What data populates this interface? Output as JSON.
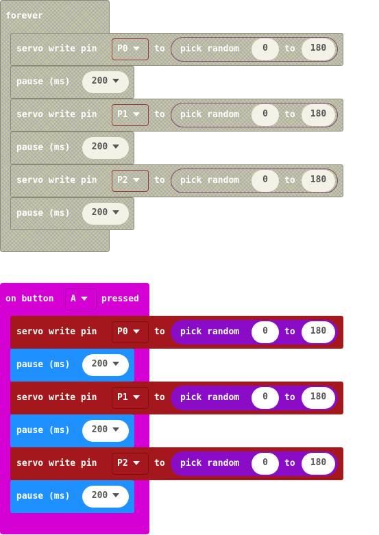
{
  "forever_block": {
    "label": "forever",
    "disabled": true,
    "statements": [
      {
        "kind": "servo",
        "label": "servo write pin",
        "pin": "P0",
        "to": "to",
        "random_label": "pick random",
        "from": "0",
        "to2": "to",
        "max": "180"
      },
      {
        "kind": "pause",
        "label": "pause (ms)",
        "value": "200"
      },
      {
        "kind": "servo",
        "label": "servo write pin",
        "pin": "P1",
        "to": "to",
        "random_label": "pick random",
        "from": "0",
        "to2": "to",
        "max": "180"
      },
      {
        "kind": "pause",
        "label": "pause (ms)",
        "value": "200"
      },
      {
        "kind": "servo",
        "label": "servo write pin",
        "pin": "P2",
        "to": "to",
        "random_label": "pick random",
        "from": "0",
        "to2": "to",
        "max": "180"
      },
      {
        "kind": "pause",
        "label": "pause (ms)",
        "value": "200"
      }
    ]
  },
  "button_block": {
    "label_prefix": "on button",
    "button": "A",
    "label_suffix": "pressed",
    "statements": [
      {
        "kind": "servo",
        "label": "servo write pin",
        "pin": "P0",
        "to": "to",
        "random_label": "pick random",
        "from": "0",
        "to2": "to",
        "max": "180"
      },
      {
        "kind": "pause",
        "label": "pause (ms)",
        "value": "200"
      },
      {
        "kind": "servo",
        "label": "servo write pin",
        "pin": "P1",
        "to": "to",
        "random_label": "pick random",
        "from": "0",
        "to2": "to",
        "max": "180"
      },
      {
        "kind": "pause",
        "label": "pause (ms)",
        "value": "200"
      },
      {
        "kind": "servo",
        "label": "servo write pin",
        "pin": "P2",
        "to": "to",
        "random_label": "pick random",
        "from": "0",
        "to2": "to",
        "max": "180"
      },
      {
        "kind": "pause",
        "label": "pause (ms)",
        "value": "200"
      }
    ]
  },
  "colors": {
    "event": "#d400d4",
    "servo": "#a4181d",
    "pause": "#1e90ff",
    "random": "#8a0cc7",
    "disabled": "#c8c899"
  }
}
